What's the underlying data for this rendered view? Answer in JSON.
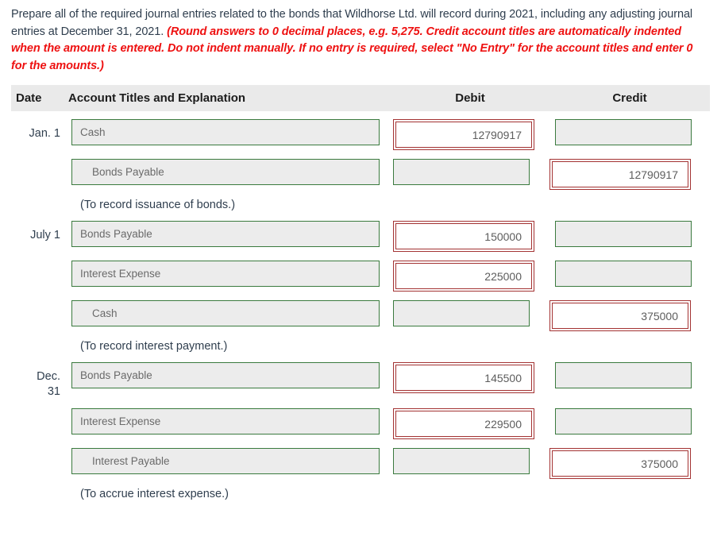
{
  "instructions": {
    "lead": "Prepare all of the required journal entries related to the bonds that Wildhorse Ltd. will record during 2021, including any adjusting journal entries at December 31, 2021. ",
    "hint": "(Round answers to 0 decimal places, e.g. 5,275. Credit account titles are automatically indented when the amount is entered. Do not indent manually. If no entry is required, select \"No Entry\" for the account titles and enter 0 for the amounts.)",
    "hint_color": "#ee1111"
  },
  "table": {
    "headers": {
      "date": "Date",
      "account": "Account Titles and Explanation",
      "debit": "Debit",
      "credit": "Credit"
    },
    "header_bg": "#eaeaea",
    "field_bg": "#ececec",
    "border_ok": "#3a7a3e",
    "border_highlight": "#a33232",
    "entries": [
      {
        "date": "Jan. 1",
        "lines": [
          {
            "account": "Cash",
            "indent": false,
            "debit": "12790917",
            "credit": ""
          },
          {
            "account": "Bonds Payable",
            "indent": true,
            "debit": "",
            "credit": "12790917"
          }
        ],
        "memo": "(To record issuance of bonds.)"
      },
      {
        "date": "July 1",
        "lines": [
          {
            "account": "Bonds Payable",
            "indent": false,
            "debit": "150000",
            "credit": ""
          },
          {
            "account": "Interest Expense",
            "indent": false,
            "debit": "225000",
            "credit": ""
          },
          {
            "account": "Cash",
            "indent": true,
            "debit": "",
            "credit": "375000"
          }
        ],
        "memo": "(To record interest payment.)"
      },
      {
        "date": "Dec.\n31",
        "lines": [
          {
            "account": "Bonds Payable",
            "indent": false,
            "debit": "145500",
            "credit": ""
          },
          {
            "account": "Interest Expense",
            "indent": false,
            "debit": "229500",
            "credit": ""
          },
          {
            "account": "Interest Payable",
            "indent": true,
            "debit": "",
            "credit": "375000"
          }
        ],
        "memo": "(To accrue interest expense.)"
      }
    ]
  }
}
